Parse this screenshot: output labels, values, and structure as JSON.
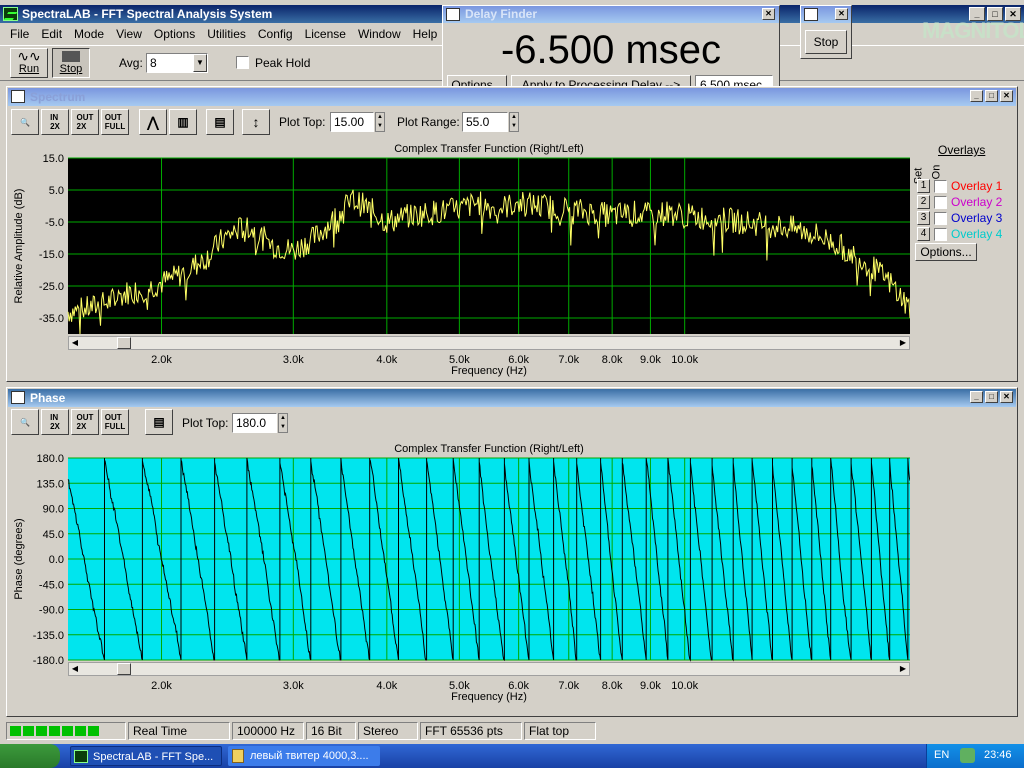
{
  "app": {
    "title": "SpectraLAB - FFT Spectral Analysis System",
    "menu": [
      "File",
      "Edit",
      "Mode",
      "View",
      "Options",
      "Utilities",
      "Config",
      "License",
      "Window",
      "Help"
    ],
    "run_label": "Run",
    "stop_label": "Stop",
    "avg_label": "Avg:",
    "avg_value": "8",
    "peak_hold_label": "Peak Hold"
  },
  "delay_finder": {
    "title": "Delay Finder",
    "value": "-6.500 msec",
    "options_label": "Options...",
    "apply_label": "Apply to Processing Delay -->",
    "delay_value": "6.500 msec"
  },
  "mini_window": {
    "stop_label": "Stop"
  },
  "watermark": "MAGNITOLA",
  "spectrum": {
    "title": "Spectrum",
    "plot_top_label": "Plot Top:",
    "plot_top_value": "15.00",
    "plot_range_label": "Plot Range:",
    "plot_range_value": "55.0",
    "overlays_header": "Overlays",
    "set_label": "Set",
    "on_label": "On",
    "overlays": [
      {
        "num": "1",
        "name": "Overlay 1",
        "color": "#ff0000"
      },
      {
        "num": "2",
        "name": "Overlay 2",
        "color": "#cc00cc"
      },
      {
        "num": "3",
        "name": "Overlay 3",
        "color": "#0000cc"
      },
      {
        "num": "4",
        "name": "Overlay 4",
        "color": "#00cccc"
      }
    ],
    "options_label": "Options..."
  },
  "phase": {
    "title": "Phase",
    "plot_top_label": "Plot Top:",
    "plot_top_value": "180.0"
  },
  "status": {
    "mode": "Real Time",
    "rate": "100000 Hz",
    "bits": "16 Bit",
    "channels": "Stereo",
    "fft": "FFT 65536 pts",
    "window": "Flat top"
  },
  "taskbar": {
    "item1": "SpectraLAB - FFT Spe...",
    "item2": "левый твитер 4000,3....",
    "lang": "EN",
    "clock": "23:46"
  },
  "chart_data": [
    {
      "type": "line",
      "title": "Complex Transfer Function (Right/Left)",
      "xlabel": "Frequency (Hz)",
      "ylabel": "Relative Amplitude (dB)",
      "x_scale": "log",
      "xlim": [
        1500,
        20000
      ],
      "ylim": [
        -40,
        15
      ],
      "yticks": [
        15.0,
        5.0,
        -5.0,
        -15.0,
        -25.0,
        -35.0
      ],
      "xtick_labels": [
        "2.0k",
        "3.0k",
        "4.0k",
        "5.0k",
        "6.0k",
        "7.0k",
        "8.0k",
        "9.0k",
        "10.0k"
      ],
      "xticks": [
        2000,
        3000,
        4000,
        5000,
        6000,
        7000,
        8000,
        9000,
        10000
      ],
      "background": "#000000",
      "grid_color": "#00aa00",
      "line_color": "#ffff66",
      "series": [
        {
          "x": [
            1500,
            1600,
            1700,
            1800,
            1900,
            2000,
            2100,
            2200,
            2300,
            2400,
            2500,
            2600,
            2800,
            3000,
            3200,
            3400,
            3600,
            3800,
            4000,
            4300,
            4600,
            5000,
            5300,
            5600,
            6000,
            6500,
            7000,
            7500,
            8000,
            8500,
            9000,
            9500,
            10000,
            11000,
            12000,
            13000,
            14000,
            15000,
            16000,
            17000,
            18000,
            19000,
            20000
          ],
          "y": [
            -33,
            -32,
            -30,
            -27,
            -26,
            -24,
            -22,
            -19,
            -16,
            -11,
            -8,
            -6,
            -12,
            -14,
            -10,
            -4,
            2,
            -1,
            -5,
            -3,
            -2,
            -1,
            1,
            -1,
            1,
            0,
            -1,
            -2,
            -3,
            -2,
            -3,
            -2,
            -3,
            -4,
            -5,
            -6,
            -7,
            -9,
            -12,
            -16,
            -20,
            -25,
            -32
          ]
        }
      ]
    },
    {
      "type": "line",
      "title": "Complex Transfer Function (Right/Left)",
      "xlabel": "Frequency (Hz)",
      "ylabel": "Phase (degrees)",
      "x_scale": "log",
      "xlim": [
        1500,
        20000
      ],
      "ylim": [
        -180,
        180
      ],
      "yticks": [
        180.0,
        135.0,
        90.0,
        45.0,
        0.0,
        -45.0,
        -90.0,
        -135.0,
        -180.0
      ],
      "xtick_labels": [
        "2.0k",
        "3.0k",
        "4.0k",
        "5.0k",
        "6.0k",
        "7.0k",
        "8.0k",
        "9.0k",
        "10.0k"
      ],
      "xticks": [
        2000,
        3000,
        4000,
        5000,
        6000,
        7000,
        8000,
        9000,
        10000
      ],
      "background": "#00e5ee",
      "grid_color": "#00aa00",
      "line_color": "#000000",
      "phase_wraps_per_decade": 40
    }
  ]
}
